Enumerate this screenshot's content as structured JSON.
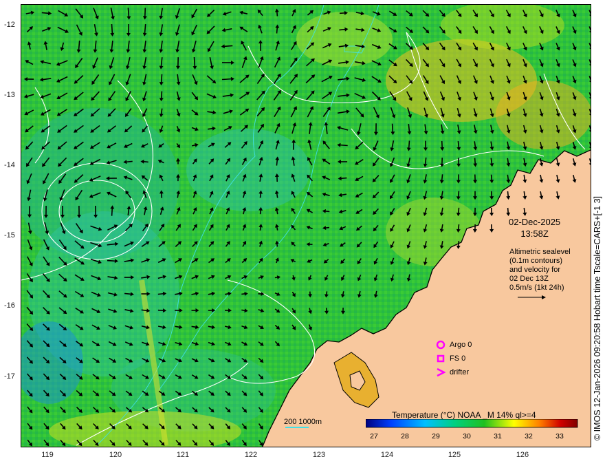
{
  "map": {
    "lat_ticks": [
      "-12",
      "-13",
      "-14",
      "-15",
      "-16",
      "-17"
    ],
    "lon_ticks": [
      "119",
      "120",
      "121",
      "122",
      "123",
      "124",
      "125",
      "126"
    ],
    "colors": {
      "land": "#f8c89e",
      "coast": "#000000",
      "contour": "#ffffff",
      "bathy": "#40e0e8"
    }
  },
  "annotations": {
    "date": "02-Dec-2025",
    "time": "13:58Z",
    "altimetry_lines": [
      "Altimetric sealevel",
      "(0.1m contours)",
      "and velocity for",
      "02 Dec 13Z",
      "0.5m/s (1kt 24h)"
    ]
  },
  "platform_legend": [
    {
      "label": "Argo 0",
      "icon": "circle-icon",
      "color": "#ff00ff"
    },
    {
      "label": "FS 0",
      "icon": "square-icon",
      "color": "#ff00ff"
    },
    {
      "label": "drifter",
      "icon": "chevron-icon",
      "color": "#ff00ff"
    }
  ],
  "colorbar": {
    "title": "Temperature (°C) NOAA _M 14% ql>=4",
    "ticks": [
      "27",
      "28",
      "29",
      "30",
      "31",
      "32",
      "33"
    ],
    "colors": [
      "#00007f",
      "#0040ff",
      "#00bfff",
      "#00d080",
      "#20c020",
      "#ffff00",
      "#ff8000",
      "#d00000",
      "#7f0000"
    ]
  },
  "depth_legend": {
    "shallow": "200",
    "deep": "1000m"
  },
  "credit": "© IMOS 12-Jan-2026 09:20:58 Hobart time Tscale=CARS+[-1 3]"
}
